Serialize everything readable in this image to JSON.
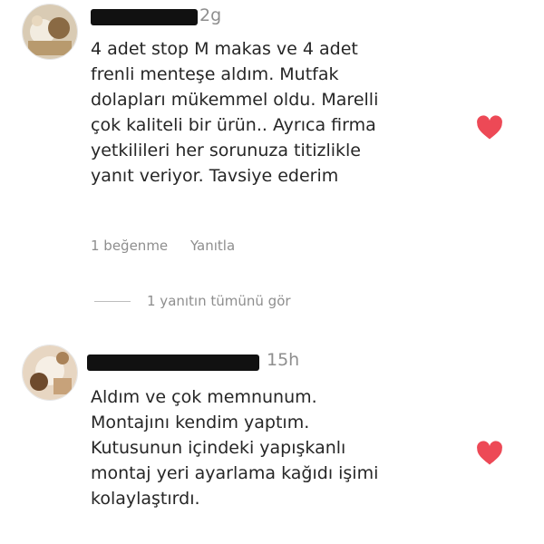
{
  "comments": [
    {
      "time": "2g",
      "lines": [
        "4 adet stop M makas ve 4 adet",
        "frenli menteşe aldım. Mutfak",
        "dolapları mükemmel oldu. Marelli",
        "çok kaliteli bir ürün.. Ayrıca firma",
        "yetkilileri her sorunuza titizlikle",
        "yanıt veriyor. Tavsiye ederim"
      ],
      "likes": "1 beğenme",
      "reply": "Yanıtla",
      "icons": {
        "like": "heart-icon",
        "color": "#ed4956"
      }
    },
    {
      "time": "15h",
      "lines": [
        "Aldım ve çok memnunum.",
        "Montajını kendim yaptım.",
        "Kutusunun içindeki yapışkanlı",
        "montaj yeri ayarlama kağıdı işimi",
        "kolaylaştırdı."
      ],
      "icons": {
        "like": "heart-icon",
        "color": "#ed4956"
      }
    }
  ],
  "view_replies": "1 yanıtın tümünü gör"
}
